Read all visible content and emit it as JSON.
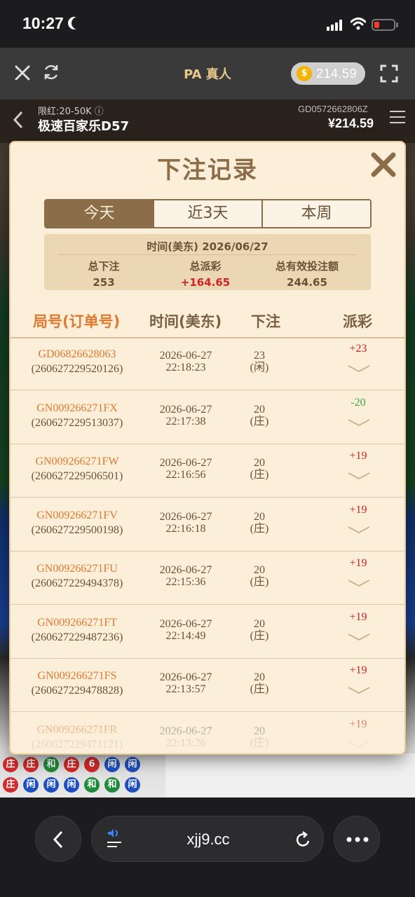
{
  "status_bar": {
    "time": "10:27"
  },
  "app_header": {
    "title": "PA 真人",
    "balance": "214.59",
    "coin_symbol": "$"
  },
  "game": {
    "limit": "限红:20-50K ⓘ",
    "table_name": "极速百家乐D57",
    "game_id": "GD0572662806Z",
    "balance": "¥214.59"
  },
  "road": [
    [
      "庄",
      "庄",
      "和",
      "庄",
      "6",
      "闲",
      "闲"
    ],
    [
      "庄",
      "闲",
      "闲",
      "闲",
      "和",
      "和",
      "闲"
    ]
  ],
  "modal": {
    "title": "下注记录",
    "tabs": [
      {
        "label": "今天",
        "active": true
      },
      {
        "label": "近3天",
        "active": false
      },
      {
        "label": "本周",
        "active": false
      }
    ],
    "summary": {
      "date_line": "时间(美东)  2026/06/27",
      "total_bet_label": "总下注",
      "total_bet": "253",
      "total_payout_label": "总派彩",
      "total_payout": "+164.65",
      "valid_bet_label": "总有效投注额",
      "valid_bet": "244.65"
    },
    "headers": {
      "order": "局号(订单号)",
      "time": "时间(美东)",
      "bet": "下注",
      "payout": "派彩"
    },
    "rows": [
      {
        "round": "GD06826628063",
        "order": "(260627229520126)",
        "date": "2026-06-27",
        "time": "22:18:23",
        "bet": "23",
        "side": "(闲)",
        "payout": "+23",
        "result": "win"
      },
      {
        "round": "GN009266271FX",
        "order": "(260627229513037)",
        "date": "2026-06-27",
        "time": "22:17:38",
        "bet": "20",
        "side": "(庄)",
        "payout": "-20",
        "result": "loss"
      },
      {
        "round": "GN009266271FW",
        "order": "(260627229506501)",
        "date": "2026-06-27",
        "time": "22:16:56",
        "bet": "20",
        "side": "(庄)",
        "payout": "+19",
        "result": "win"
      },
      {
        "round": "GN009266271FV",
        "order": "(260627229500198)",
        "date": "2026-06-27",
        "time": "22:16:18",
        "bet": "20",
        "side": "(庄)",
        "payout": "+19",
        "result": "win"
      },
      {
        "round": "GN009266271FU",
        "order": "(260627229494378)",
        "date": "2026-06-27",
        "time": "22:15:36",
        "bet": "20",
        "side": "(庄)",
        "payout": "+19",
        "result": "win"
      },
      {
        "round": "GN009266271FT",
        "order": "(260627229487236)",
        "date": "2026-06-27",
        "time": "22:14:49",
        "bet": "20",
        "side": "(庄)",
        "payout": "+19",
        "result": "win"
      },
      {
        "round": "GN009266271FS",
        "order": "(260627229478828)",
        "date": "2026-06-27",
        "time": "22:13:57",
        "bet": "20",
        "side": "(庄)",
        "payout": "+19",
        "result": "win"
      },
      {
        "round": "GN009266271FR",
        "order": "(260627229471121)",
        "date": "2026-06-27",
        "time": "22:13:26",
        "bet": "20",
        "side": "(庄)",
        "payout": "+19",
        "result": "win"
      }
    ]
  },
  "browser": {
    "url": "xjj9.cc"
  },
  "colors": {
    "accent": "#8b6d4a",
    "win": "#d0232b",
    "loss": "#3fa34d",
    "order": "#e2772f"
  }
}
